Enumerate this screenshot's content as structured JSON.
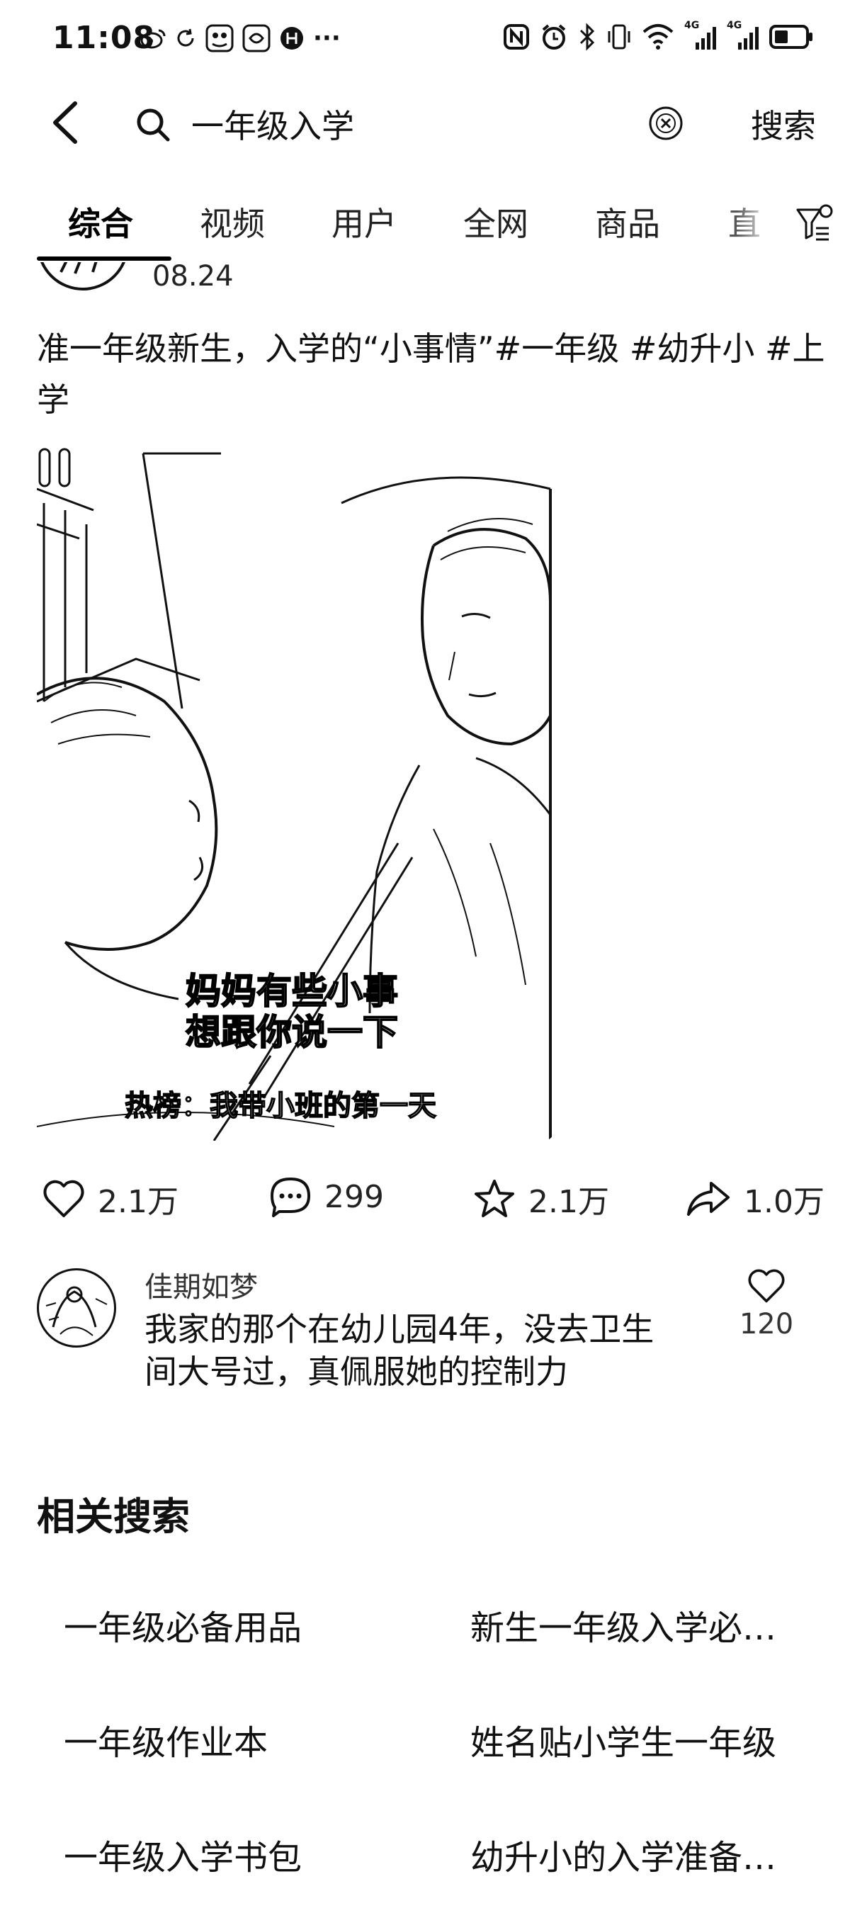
{
  "status_bar": {
    "time": "11:08",
    "left_icons": [
      "weibo-icon",
      "refresh-icon",
      "app-icon",
      "app-icon",
      "app-icon",
      "more-icon"
    ],
    "right_icons": [
      "nfc-icon",
      "alarm-icon",
      "bluetooth-icon",
      "vibrate-icon",
      "wifi-icon",
      "signal-4g-icon",
      "signal-4g-icon",
      "battery-icon"
    ],
    "more": "···",
    "signal_label_1": "4G",
    "signal_label_2": "4G"
  },
  "search": {
    "query": "一年级入学",
    "submit_label": "搜索"
  },
  "tabs": {
    "items": [
      "综合",
      "视频",
      "用户",
      "全网",
      "商品"
    ],
    "overflow_label": "直",
    "active_index": 0
  },
  "post": {
    "date": "08.24",
    "title": "准一年级新生，入学的“小事情”#一年级 #幼升小 #上学",
    "video": {
      "caption_line1": "妈妈有些小事",
      "caption_line2": "想跟你说一下",
      "hot_label": "热榜：我带小班的第一天"
    },
    "actions": {
      "likes": "2.1万",
      "comments": "299",
      "favorites": "2.1万",
      "shares": "1.0万"
    }
  },
  "comment": {
    "username": "佳期如梦",
    "text": "我家的那个在幼儿园4年，没去卫生间大号过，真佩服她的控制力",
    "likes": "120"
  },
  "related": {
    "title": "相关搜索",
    "items": [
      "一年级必备用品",
      "新生一年级入学必…",
      "一年级作业本",
      "姓名贴小学生一年级",
      "一年级入学书包",
      "幼升小的入学准备…"
    ]
  },
  "colors": {
    "text": "#111111",
    "background": "#ffffff"
  }
}
